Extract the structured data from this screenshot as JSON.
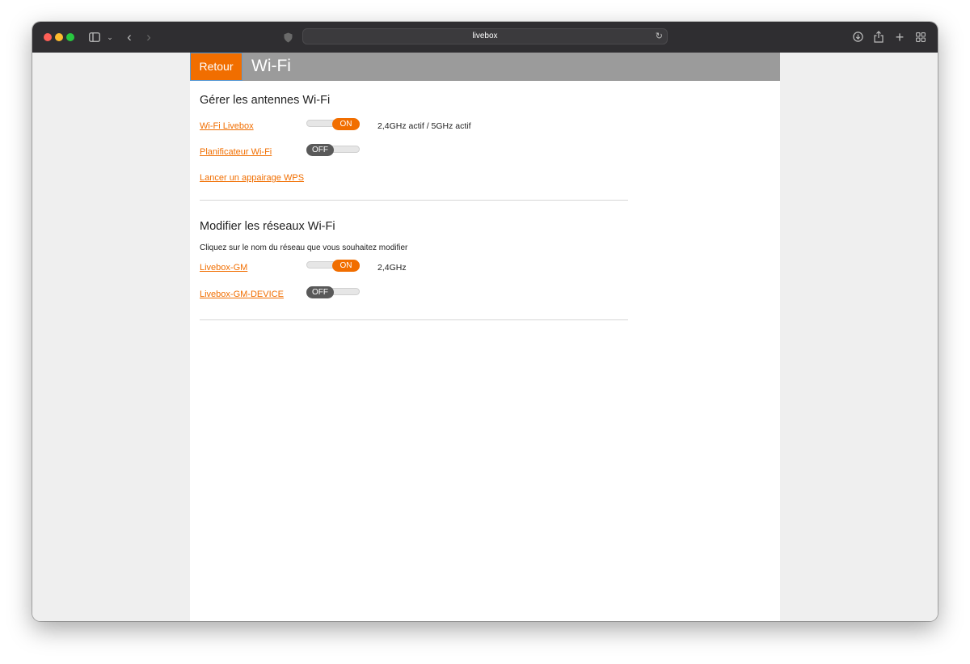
{
  "browser": {
    "url": "livebox",
    "icons": {
      "sidebar": "sidebar-icon",
      "back": "chevron-left-icon",
      "forward": "chevron-right-icon",
      "shield": "shield-icon",
      "reload": "reload-icon",
      "download": "download-icon",
      "share": "share-icon",
      "new_tab": "plus-icon",
      "tab_overview": "grid-icon"
    }
  },
  "header": {
    "back_label": "Retour",
    "title": "Wi-Fi"
  },
  "antennas": {
    "title": "Gérer les antennes Wi-Fi",
    "items": [
      {
        "label": "Wi-Fi Livebox",
        "toggle": "ON",
        "status": "2,4GHz actif / 5GHz actif"
      },
      {
        "label": "Planificateur Wi-Fi",
        "toggle": "OFF"
      },
      {
        "label": "Lancer un appairage WPS"
      }
    ]
  },
  "networks": {
    "title": "Modifier les réseaux Wi-Fi",
    "description": "Cliquez sur le nom du réseau que vous souhaitez modifier",
    "items": [
      {
        "label": "Livebox-GM",
        "toggle": "ON",
        "status": "2,4GHz"
      },
      {
        "label": "Livebox-GM-DEVICE",
        "toggle": "OFF"
      }
    ]
  },
  "colors": {
    "accent": "#f16e00",
    "header_bar": "#9b9b9b",
    "toggle_off": "#595959"
  }
}
